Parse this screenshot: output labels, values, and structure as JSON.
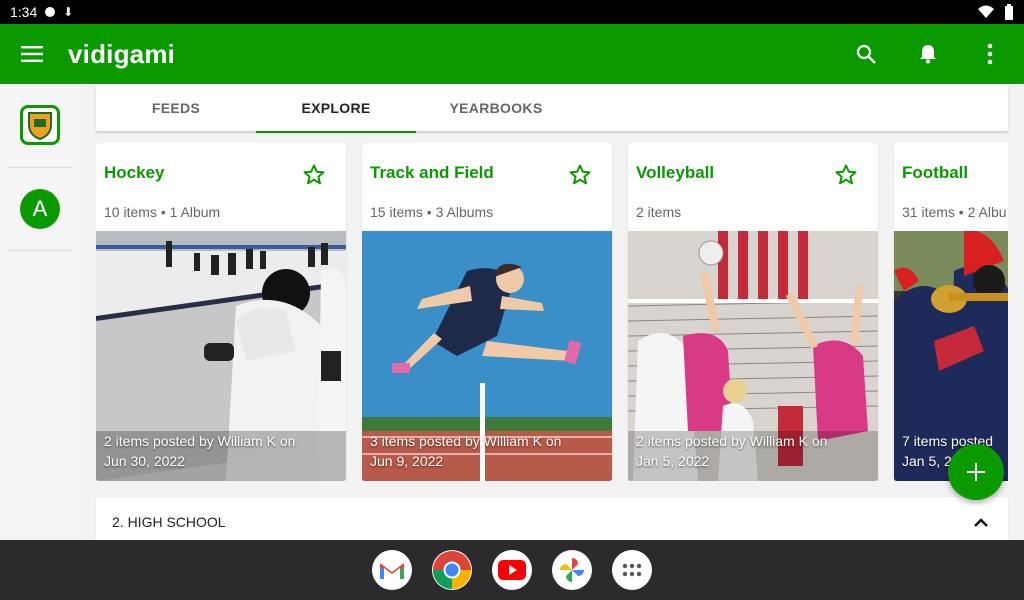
{
  "status": {
    "time": "1:34"
  },
  "appbar": {
    "brand": "vidigami",
    "color": "#0a9a00"
  },
  "rail": {
    "avatar_letter": "A"
  },
  "tabs": [
    {
      "label": "FEEDS"
    },
    {
      "label": "EXPLORE"
    },
    {
      "label": "YEARBOOKS"
    }
  ],
  "active_tab": "EXPLORE",
  "cards": [
    {
      "title": "Hockey",
      "meta": "10 items • 1 Album",
      "caption_line1": "2 items posted by William K on",
      "caption_line2": "Jun 30, 2022",
      "image": "hockey-photo"
    },
    {
      "title": "Track and Field",
      "meta": "15 items • 3 Albums",
      "caption_line1": "3 items posted by William K on",
      "caption_line2": "Jun 9, 2022",
      "image": "hurdler-illustration"
    },
    {
      "title": "Volleyball",
      "meta": "2 items",
      "caption_line1": "2 items posted by William K on",
      "caption_line2": "Jan 5, 2022",
      "image": "volleyball-photo"
    },
    {
      "title": "Football",
      "meta": "31 items • 2 Albu",
      "caption_line1": "7 items posted",
      "caption_line2": "Jan 5, 2",
      "image": "marching-band-photo"
    }
  ],
  "section": {
    "label": "2. HIGH SCHOOL"
  },
  "dock": [
    "gmail-icon",
    "chrome-icon",
    "youtube-icon",
    "photos-icon",
    "apps-icon"
  ]
}
